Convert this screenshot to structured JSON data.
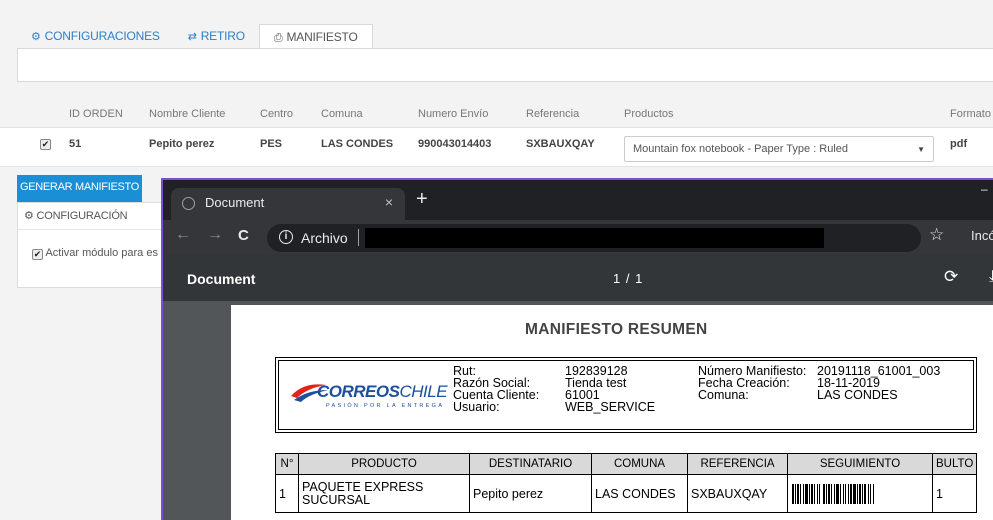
{
  "tabs": [
    {
      "icon": "cogs-icon",
      "glyph": "⚙",
      "label": "CONFIGURACIONES",
      "active": false
    },
    {
      "icon": "exchange-icon",
      "glyph": "⇄",
      "label": "RETIRO",
      "active": false
    },
    {
      "icon": "print-icon",
      "glyph": "⎙",
      "label": "MANIFIESTO",
      "active": true
    }
  ],
  "orders_table": {
    "headers": [
      "ID ORDEN",
      "Nombre Cliente",
      "Centro",
      "Comuna",
      "Numero Envío",
      "Referencia",
      "Productos",
      "Formato"
    ],
    "row": {
      "checked": true,
      "id": "51",
      "cliente": "Pepito perez",
      "centro": "PES",
      "comuna": "LAS CONDES",
      "numero_envio": "990043014403",
      "referencia": "SXBAUXQAY",
      "producto_selected": "Mountain fox notebook - Paper Type : Ruled",
      "formato": "pdf"
    }
  },
  "generate_button": "GENERAR MANIFIESTO",
  "config_panel": {
    "title": "CONFIGURACIÓN",
    "checkbox_label": "Activar módulo para es"
  },
  "browser": {
    "tab_title": "Document",
    "tab_close": "×",
    "new_tab": "+",
    "url_prefix": "Archivo",
    "incognito_label": "Incó",
    "pdf_title": "Document",
    "pdf_pages": "1 / 1"
  },
  "document": {
    "title": "MANIFIESTO RESUMEN",
    "logo": {
      "brand_a": "CORREOS",
      "brand_b": "CHILE",
      "tagline": "PASIÓN POR LA ENTREGA"
    },
    "header_labels_1": [
      "Rut:",
      "Razón Social:",
      "Cuenta Cliente:",
      "Usuario:"
    ],
    "header_values_1": [
      "192839128",
      "Tienda test",
      "61001",
      "WEB_SERVICE"
    ],
    "header_labels_2": [
      "Número Manifiesto:",
      "Fecha Creación:",
      "Comuna:"
    ],
    "header_values_2": [
      "20191118_61001_003",
      "18-11-2019",
      "LAS CONDES"
    ],
    "items_headers": [
      "N°",
      "PRODUCTO",
      "DESTINATARIO",
      "COMUNA",
      "REFERENCIA",
      "SEGUIMIENTO",
      "BULTO"
    ],
    "items_row": {
      "n": "1",
      "producto_line1": "PAQUETE EXPRESS",
      "producto_line2": "SUCURSAL",
      "destinatario": "Pepito perez",
      "comuna": "LAS CONDES",
      "referencia": "SXBAUXQAY",
      "bulto": "1"
    }
  },
  "colors": {
    "link_blue": "#2d7fc4",
    "button_blue": "#1b8fd6",
    "chrome_dark": "#202124",
    "chrome_toolbar": "#35363a",
    "pdf_bg": "#525659",
    "window_border": "#7b4fd1"
  }
}
